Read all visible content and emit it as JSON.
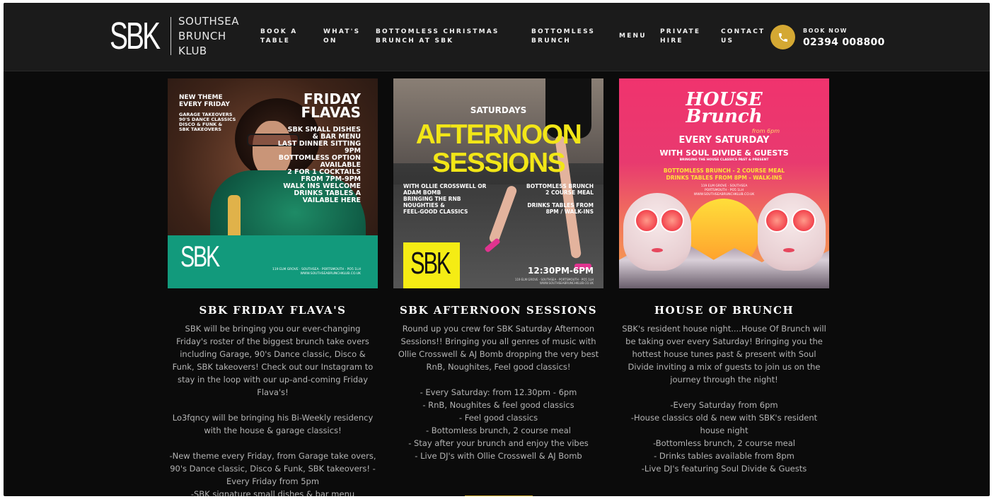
{
  "header": {
    "logo_mark": "SBK",
    "logo_lines": [
      "SOUTHSEA",
      "BRUNCH",
      "KLUB"
    ],
    "nav": [
      {
        "line1": "BOOK A",
        "line2": "TABLE"
      },
      {
        "line1": "WHAT'S",
        "line2": "ON"
      },
      {
        "line1": "BOTTOMLESS CHRISTMAS",
        "line2": "BRUNCH AT SBK"
      },
      {
        "line1": "BOTTOMLESS",
        "line2": "BRUNCH"
      },
      {
        "line1": "MENU",
        "line2": ""
      },
      {
        "line1": "PRIVATE",
        "line2": "HIRE"
      },
      {
        "line1": "CONTACT",
        "line2": "US"
      }
    ],
    "book_label": "BOOK NOW",
    "phone": "02394 008800",
    "accent": "#d4a833"
  },
  "cards": [
    {
      "title": "SBK FRIDAY FLAVA'S",
      "description": "SBK will be bringing you our ever-changing Friday's roster of the biggest brunch take overs including Garage, 90's Dance classic, Disco & Funk, SBK takeovers! Check out our Instagram to stay in the loop with our up-and-coming Friday Flava's!\n\nLo3fqncy will be bringing his Bi-Weekly residency with the house & garage classics!\n\n-New theme every Friday, from Garage take overs, 90's Dance classic, Disco & Funk, SBK takeovers! - Every Friday from 5pm\n-SBK signature small dishes & bar menu",
      "poster": {
        "theme": "NEW THEME\nEVERY FRIDAY",
        "small": "GARAGE TAKEOVERS\n90'S DANCE CLASSICS\nDISCO & FUNK &\nSBK TAKEOVERS",
        "headline": "FRIDAY\nFLAVAS",
        "lines": "SBK SMALL DISHES\n& BAR MENU\nLAST DINNER SITTING\n9PM\nBOTTOMLESS OPTION\nAVAILABLE\n2 FOR 1 COCKTAILS\nFROM 7PM-9PM\nWALK INS WELCOME\nDRINKS TABLES A\nVAILABLE HERE",
        "logo": "SBK",
        "address": "119 ELM GROVE · SOUTHSEA · PORTSMOUTH · PO5 1LH\nWWW.SOUTHSEABRUNCHKLUB.CO.UK"
      }
    },
    {
      "title": "SBK AFTERNOON SESSIONS",
      "description": "Round up you crew for SBK Saturday Afternoon Sessions!! Bringing you all genres of music with Ollie Crosswell & AJ Bomb dropping the very best RnB, Noughites, Feel good classics!\n\n- Every Saturday: from 12.30pm - 6pm\n- RnB, Noughites & feel good classics\n- Feel good classics\n- Bottomless brunch, 2 course meal\n- Stay after your brunch and enjoy the vibes\n- Live DJ's with Ollie Crosswell & AJ Bomb",
      "poster": {
        "day": "SATURDAYS",
        "headline": "AFTERNOON\nSESSIONS",
        "left": "WITH OLLIE CROSSWELL OR\nADAM BOMB\nBRINGING THE RNB\nNOUGHTIES &\nFEEL-GOOD CLASSICS",
        "right": "BOTTOMLESS BRUNCH\n2 COURSE MEAL\n\nDRINKS TABLES FROM\n8PM / WALK-INS",
        "logo": "SBK",
        "time": "12:30PM-6PM",
        "address": "119 ELM GROVE · SOUTHSEA · PORTSMOUTH · PO5 1LH\nWWW.SOUTHSEABRUNCHKLUB.CO.UK"
      }
    },
    {
      "title": "HOUSE OF BRUNCH",
      "description": "SBK's resident house night....House Of Brunch will be taking over every Saturday! Bringing you the hottest house tunes past & present with Soul Divide inviting a mix of guests to join us on the journey through the night!\n\n-Every Saturday from 6pm\n-House classics old & new with SBK's resident house night\n-Bottomless brunch, 2 course meal\n- Drinks tables available from 8pm\n-Live DJ's featuring Soul Divide & Guests",
      "poster": {
        "headline": "HOUSE\nBrunch",
        "from": "from 6pm",
        "every": "EVERY SATURDAY",
        "with": "WITH SOUL DIVIDE & GUESTS",
        "bringing": "BRINGING THE HOUSE CLASSICS PAST & PRESENT",
        "offer": "BOTTOMLESS BRUNCH - 2 COURSE MEAL\nDRINKS TABLES FROM 8PM - WALK-INS",
        "address": "119 ELM GROVE · SOUTHSEA\nPORTSMOUTH · PO5 1LH\nWWW.SOUTHSEABRUNCHKLUB.CO.UK"
      }
    }
  ]
}
